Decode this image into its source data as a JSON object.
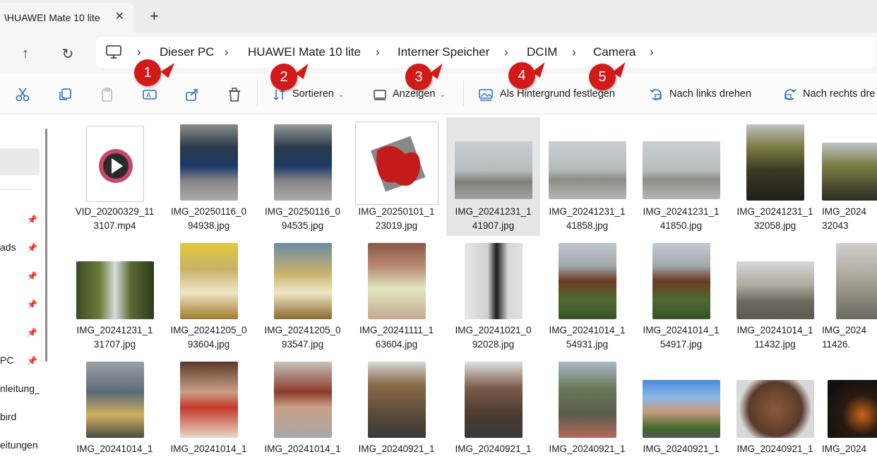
{
  "tab": {
    "title": "\\HUAWEI Mate 10 lite",
    "close": "✕",
    "add": "+"
  },
  "nav": {
    "up_icon": "arrow-up-icon",
    "refresh_icon": "refresh-icon",
    "up": "↑",
    "refresh": "↻"
  },
  "breadcrumbs": [
    "Dieser PC",
    "HUAWEI Mate 10 lite",
    "Interner Speicher",
    "DCIM",
    "Camera"
  ],
  "callouts": [
    "1",
    "2",
    "3",
    "4",
    "5"
  ],
  "toolbar": {
    "sort": "Sortieren",
    "view": "Anzeigen",
    "wallpaper": "Als Hintergrund festlegen",
    "rotate_left": "Nach links drehen",
    "rotate_right": "Nach rechts dre"
  },
  "sidebar": {
    "items": [
      "ads",
      "PC",
      "nleitung_",
      "bird",
      "eitungen"
    ]
  },
  "files": [
    [
      "VID_20200329_11\n3107.mp4",
      "IMG_20250116_0\n94938.jpg",
      "IMG_20250116_0\n94535.jpg",
      "IMG_20250101_1\n23019.jpg",
      "IMG_20241231_1\n41907.jpg",
      "IMG_20241231_1\n41858.jpg",
      "IMG_20241231_1\n41850.jpg",
      "IMG_20241231_1\n32058.jpg",
      "IMG_2024\n32043"
    ],
    [
      "IMG_20241231_1\n31707.jpg",
      "IMG_20241205_0\n93604.jpg",
      "IMG_20241205_0\n93547.jpg",
      "IMG_20241111_1\n63604.jpg",
      "IMG_20241021_0\n92028.jpg",
      "IMG_20241014_1\n54931.jpg",
      "IMG_20241014_1\n54917.jpg",
      "IMG_20241014_1\n11432.jpg",
      "IMG_2024\n11426."
    ],
    [
      "IMG_20241014_1",
      "IMG_20241014_1",
      "IMG_20241014_1",
      "IMG_20240921_1",
      "IMG_20240921_1",
      "IMG_20240921_1",
      "IMG_20240921_1",
      "IMG_20240921_1",
      "IMG_2024"
    ]
  ],
  "colors": {
    "accent": "#2a6fbf",
    "callout": "#d41919",
    "selected": "#e6e6e6"
  }
}
